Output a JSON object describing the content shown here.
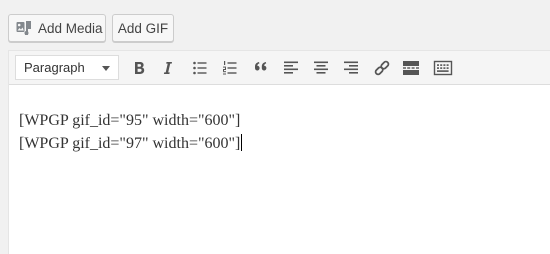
{
  "media_buttons": {
    "add_media_label": "Add Media",
    "add_gif_label": "Add GIF"
  },
  "toolbar": {
    "format_select_value": "Paragraph",
    "buttons": [
      "bold-icon",
      "italic-icon",
      "bulleted-list-icon",
      "numbered-list-icon",
      "blockquote-icon",
      "align-left-icon",
      "align-center-icon",
      "align-right-icon",
      "insert-link-icon",
      "read-more-icon",
      "toolbar-toggle-icon"
    ]
  },
  "editor": {
    "lines": [
      "[WPGP gif_id=\"95\" width=\"600\"]",
      "[WPGP gif_id=\"97\" width=\"600\"]"
    ]
  }
}
